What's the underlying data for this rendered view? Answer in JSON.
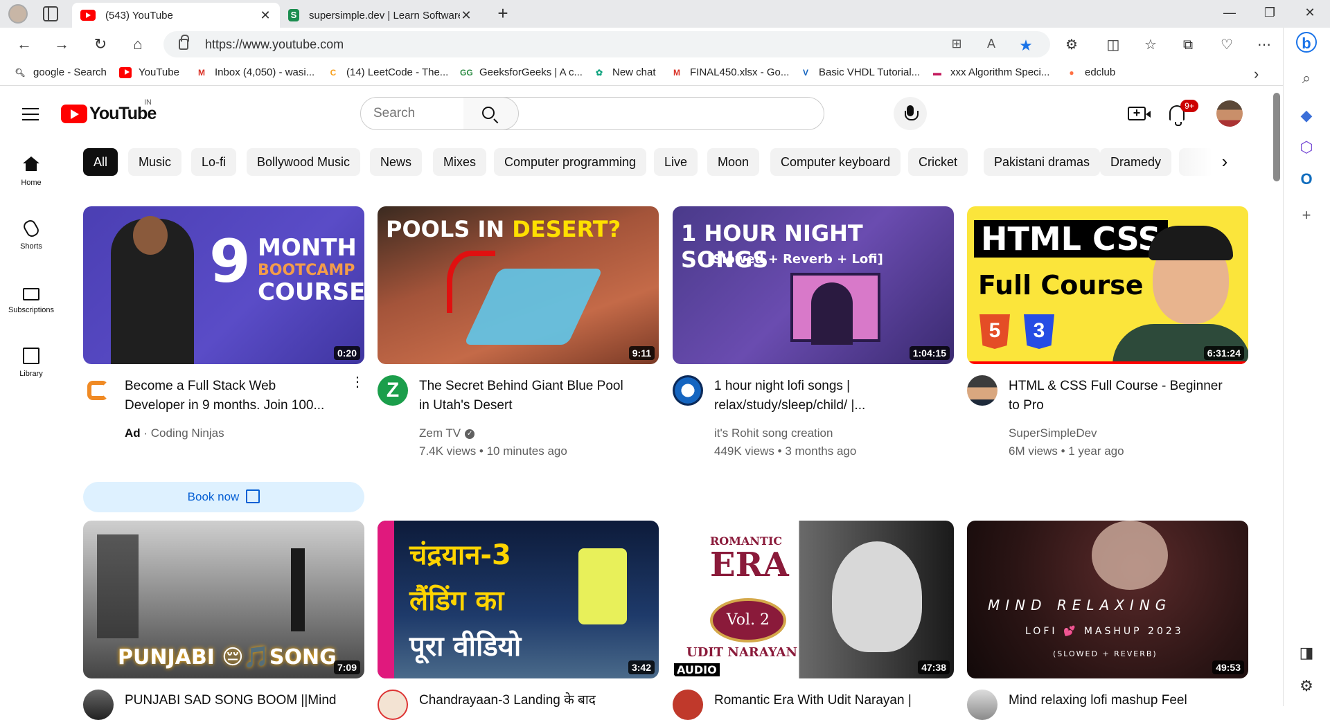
{
  "browser": {
    "tabs": [
      {
        "title": "(543) YouTube",
        "active": true
      },
      {
        "title": "supersimple.dev | Learn Software",
        "active": false
      }
    ],
    "url": "https://www.youtube.com",
    "bookmarks": [
      {
        "label": "google - Search",
        "icon": "google-icon"
      },
      {
        "label": "YouTube",
        "icon": "youtube-icon"
      },
      {
        "label": "Inbox (4,050) - wasi...",
        "icon": "gmail-icon"
      },
      {
        "label": "(14) LeetCode - The...",
        "icon": "leetcode-icon"
      },
      {
        "label": "GeeksforGeeks | A c...",
        "icon": "gfg-icon"
      },
      {
        "label": "New chat",
        "icon": "chatgpt-icon"
      },
      {
        "label": "FINAL450.xlsx - Go...",
        "icon": "gmail-icon"
      },
      {
        "label": "Basic VHDL Tutorial...",
        "icon": "vhdl-icon"
      },
      {
        "label": "xxx Algorithm Speci...",
        "icon": "doc-icon"
      },
      {
        "label": "edclub",
        "icon": "edclub-icon"
      }
    ]
  },
  "youtube": {
    "logo_text": "YouTube",
    "region": "IN",
    "search_placeholder": "Search",
    "notifications_badge": "9+",
    "guide": [
      {
        "label": "Home"
      },
      {
        "label": "Shorts"
      },
      {
        "label": "Subscriptions"
      },
      {
        "label": "Library"
      }
    ],
    "chips": [
      "All",
      "Music",
      "Lo-fi",
      "Bollywood Music",
      "News",
      "Mixes",
      "Computer programming",
      "Live",
      "Moon",
      "Computer keyboard",
      "Cricket",
      "Pakistani dramas",
      "Dramedy"
    ],
    "videos": [
      {
        "title": "Become a Full Stack Web Developer in 9 months. Join 100...",
        "ad_label": "Ad",
        "channel": "Coding Ninjas",
        "meta": "",
        "duration": "0:20",
        "cta": "Book now",
        "thumb_text": [
          "9",
          "MONTH",
          "BOOTCAMP",
          "COURSE"
        ]
      },
      {
        "title": "The Secret Behind Giant Blue Pool in Utah's Desert",
        "channel": "Zem TV",
        "meta": "7.4K views • 10 minutes ago",
        "duration": "9:11",
        "thumb_text": [
          "POOLS IN",
          "DESERT?"
        ]
      },
      {
        "title": "1 hour night lofi songs | relax/study/sleep/child/ |...",
        "channel": "it's Rohit song creation",
        "meta": "449K views • 3 months ago",
        "duration": "1:04:15",
        "thumb_text": [
          "1 HOUR NIGHT SONGS",
          "[Slowed + Reverb + Lofi]"
        ]
      },
      {
        "title": "HTML & CSS Full Course - Beginner to Pro",
        "channel": "SuperSimpleDev",
        "meta": "6M views • 1 year ago",
        "duration": "6:31:24",
        "thumb_text": [
          "HTML CSS",
          "Full Course"
        ]
      },
      {
        "title": "PUNJABI SAD SONG BOOM ||Mind",
        "duration": "7:09",
        "thumb_text": [
          "PUNJABI 😔🎵SONG"
        ]
      },
      {
        "title": "Chandrayaan-3 Landing के बाद",
        "duration": "3:42",
        "thumb_text": [
          "चंद्रयान-3",
          "लैंडिंग का",
          "पूरा वीडियो"
        ]
      },
      {
        "title": "Romantic Era With Udit Narayan |",
        "duration": "47:38",
        "thumb_text": [
          "ROMANTIC",
          "ERA",
          "Vol. 2",
          "UDIT NARAYAN",
          "AUDIO"
        ]
      },
      {
        "title": "Mind relaxing lofi mashup Feel",
        "duration": "49:53",
        "thumb_text": [
          "MIND RELAXING",
          "LOFI 💕 MASHUP 2023",
          "(SLOWED + REVERB)"
        ]
      }
    ]
  },
  "colors": {
    "brand_red": "#ff0000",
    "link_blue": "#065fd4",
    "chip_selected": "#0f0f0f"
  }
}
